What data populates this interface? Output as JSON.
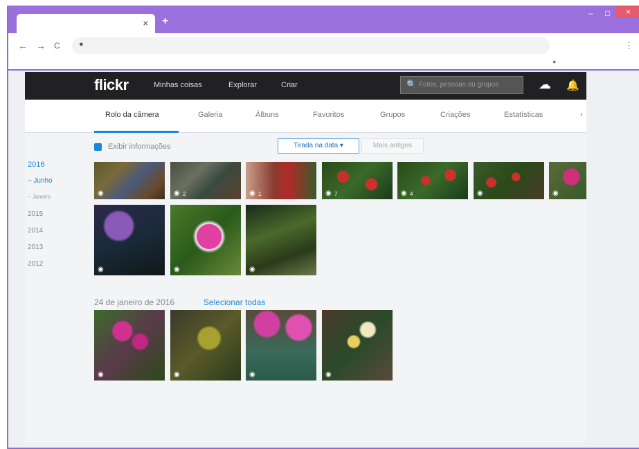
{
  "browser": {
    "tab_close": "×",
    "new_tab": "+",
    "window_min": "–",
    "window_max": "□",
    "window_close": "×",
    "back": "←",
    "forward": "→",
    "reload": "C",
    "lock": "●",
    "menu": "⋮",
    "extension": "●"
  },
  "flickr": {
    "logo": "flickr",
    "nav": [
      "Minhas coisas",
      "Explorar",
      "Criar"
    ],
    "search_placeholder": "Fotos, pessoas ou grupos",
    "search_icon": "🔍",
    "upload_icon": "☁",
    "bell_icon": "🔔",
    "tabs": [
      "Rolo da câmera",
      "Galeria",
      "Álbuns",
      "Favoritos",
      "Grupos",
      "Criações",
      "Estatísticas",
      "›"
    ],
    "active_tab": "Rolo da câmera",
    "options": {
      "show_info": "Exibir informações",
      "sort": "Tirada na data ▾",
      "select": "Mais antigos"
    },
    "sidebar": {
      "years": [
        "2016",
        "2015",
        "2014",
        "2013",
        "2012"
      ],
      "active_year": "2016",
      "month": "– Junho",
      "submonth": "– Janeiro"
    },
    "group2": {
      "date": "24 de janeiro de 2016",
      "select_all": "Selecionar todas"
    },
    "photo_counts": [
      "",
      "2",
      "1",
      "7",
      "4",
      "",
      "",
      "",
      "",
      "",
      "",
      "",
      "",
      ""
    ],
    "eye_icon": "◉"
  }
}
